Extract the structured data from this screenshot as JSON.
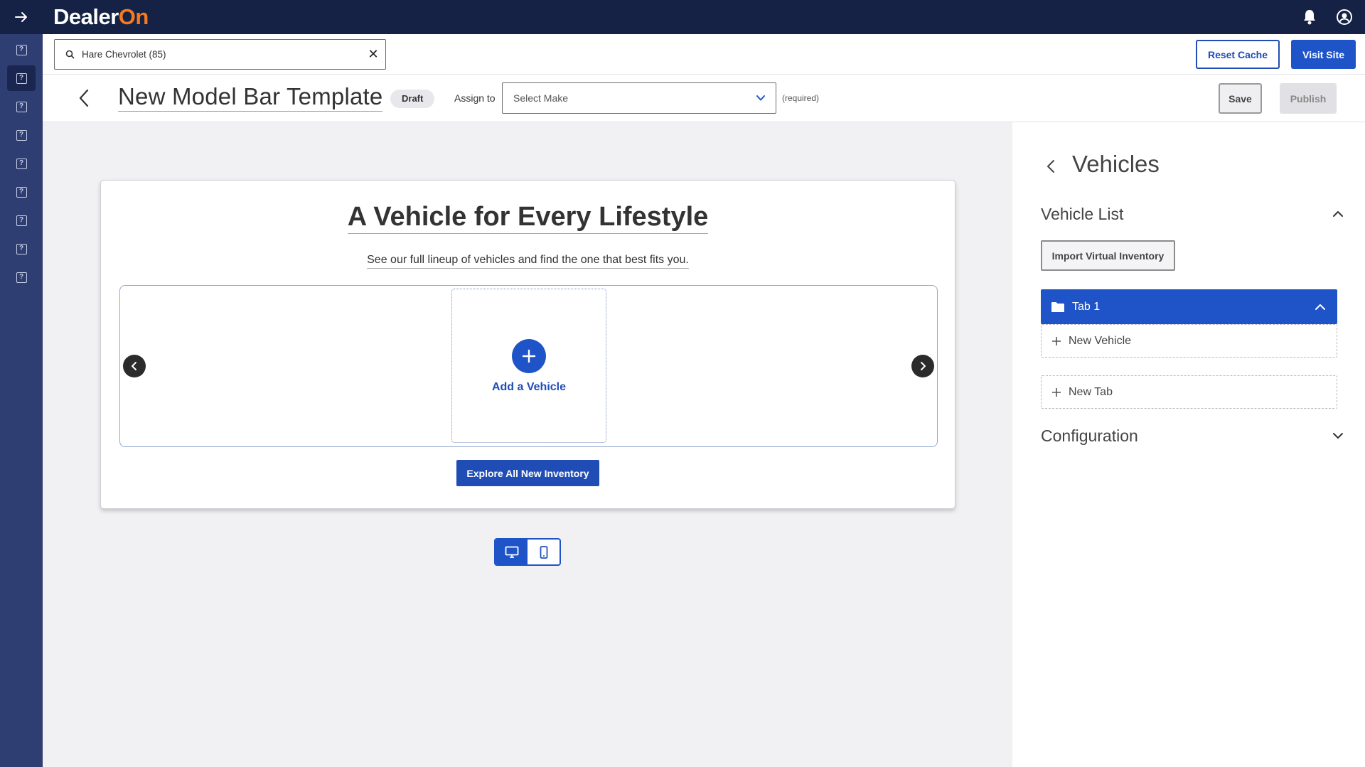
{
  "brand": {
    "logo_text_a": "Dealer",
    "logo_text_b": "On",
    "accent": "#f47a20",
    "navy": "#152245",
    "primary": "#1f54c8"
  },
  "rail": {
    "expand_icon": "arrow-right-icon",
    "items": [
      "help-icon",
      "help-icon",
      "help-icon",
      "help-icon",
      "help-icon",
      "help-icon",
      "help-icon",
      "help-icon",
      "help-icon"
    ]
  },
  "topbar": {
    "notification_icon": "bell-icon",
    "account_icon": "user-circle-icon"
  },
  "search": {
    "value": "Hare Chevrolet (85)",
    "clear_label": "✕"
  },
  "actions": {
    "reset_cache": "Reset Cache",
    "visit_site": "Visit Site"
  },
  "editor": {
    "title": "New Model Bar Template",
    "status": "Draft",
    "assign_label": "Assign to",
    "select_placeholder": "Select Make",
    "required_note": "(required)",
    "save": "Save",
    "publish": "Publish"
  },
  "preview": {
    "heading": "A Vehicle for Every Lifestyle",
    "subheading": "See our full lineup of vehicles and find the one that best fits you.",
    "add_vehicle": "Add a Vehicle",
    "cta": "Explore All New Inventory",
    "device_modes": [
      "desktop-icon",
      "mobile-icon"
    ]
  },
  "panel": {
    "title": "Vehicles",
    "vehicle_list_title": "Vehicle List",
    "import_button": "Import Virtual Inventory",
    "tab_label": "Tab 1",
    "new_vehicle": "New Vehicle",
    "new_tab": "New Tab",
    "configuration_title": "Configuration"
  }
}
